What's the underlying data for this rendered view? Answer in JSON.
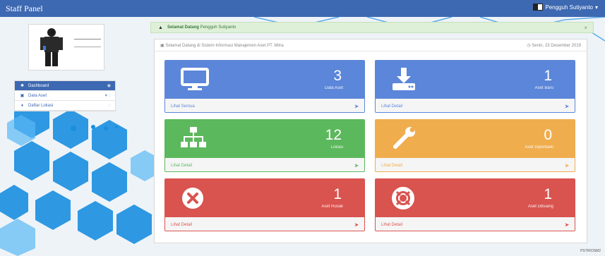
{
  "topbar": {
    "brand": "Staff Panel",
    "user_name": "Pengguh Sutiyanto",
    "dropdown_caret": "▾"
  },
  "sidebar": {
    "items": [
      {
        "label": "Dashboard",
        "icon": "home-icon",
        "glyph": "✱",
        "right": "◉"
      },
      {
        "label": "Data Aset",
        "icon": "table-icon",
        "glyph": "▣",
        "right": "▾ ◌"
      },
      {
        "label": "Daftar Lokasi",
        "icon": "map-marker-icon",
        "glyph": "♦",
        "right": "◌"
      }
    ]
  },
  "alert": {
    "strong": "Selamat Datang",
    "name": "Pengguh Sutiyanto",
    "close": "×"
  },
  "panel": {
    "heading": "Selamat Datang di Sistem Informasi Manajemen Aset PT. Mitra",
    "date": "Senin, 23 Desember 2019"
  },
  "cards": [
    {
      "number": "3",
      "subtitle": "Data Aset",
      "footer": "Lihat Semua",
      "color": "#5b86d9",
      "icon": "desktop-icon"
    },
    {
      "number": "1",
      "subtitle": "Aset Baru",
      "footer": "Lihat Detail",
      "color": "#5b86d9",
      "icon": "download-icon"
    },
    {
      "number": "12",
      "subtitle": "Lokasi",
      "footer": "Lihat Detail",
      "color": "#5cb85c",
      "icon": "sitemap-icon"
    },
    {
      "number": "0",
      "subtitle": "Aset Diperbaiki",
      "footer": "Lihat Detail",
      "color": "#f0ad4e",
      "icon": "wrench-icon"
    },
    {
      "number": "1",
      "subtitle": "Aset Rusak",
      "footer": "Lihat Detail",
      "color": "#d9534f",
      "icon": "times-circle-icon"
    },
    {
      "number": "1",
      "subtitle": "Aset Dibuang",
      "footer": "Lihat Detail",
      "color": "#d9534f",
      "icon": "life-ring-icon"
    }
  ],
  "corner_label": "PSTRIOSM2"
}
